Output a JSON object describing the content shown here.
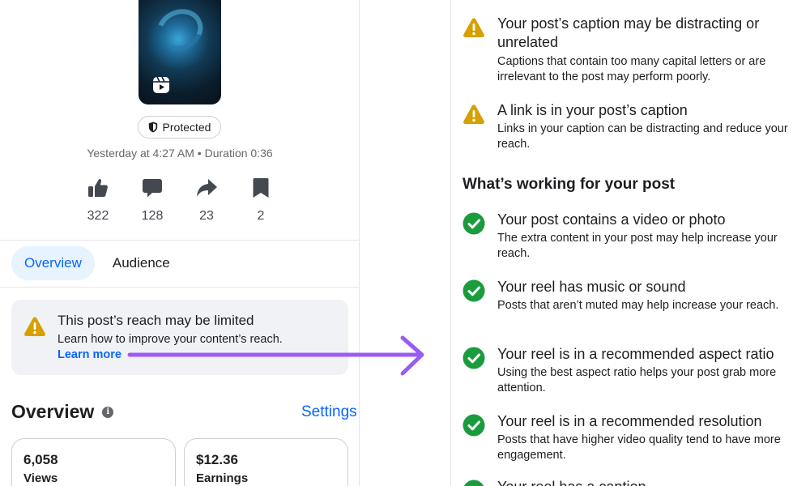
{
  "post": {
    "protected_label": "Protected",
    "meta": "Yesterday at 4:27 AM • Duration 0:36",
    "stats": [
      {
        "icon": "like-icon",
        "value": "322"
      },
      {
        "icon": "comment-icon",
        "value": "128"
      },
      {
        "icon": "share-icon",
        "value": "23"
      },
      {
        "icon": "save-icon",
        "value": "2"
      }
    ]
  },
  "tabs": [
    {
      "label": "Overview",
      "active": true
    },
    {
      "label": "Audience",
      "active": false
    }
  ],
  "reach_notice": {
    "title": "This post’s reach may be limited",
    "description": "Learn how to improve your content’s reach.",
    "link": "Learn more"
  },
  "overview": {
    "heading": "Overview",
    "settings_link": "Settings",
    "metrics": [
      {
        "value": "6,058",
        "label": "Views"
      },
      {
        "value": "$12.36",
        "label": "Earnings"
      }
    ]
  },
  "warnings": [
    {
      "title": "Your post’s caption may be distracting or unrelated",
      "description": "Captions that contain too many capital letters or are irrelevant to the post may perform poorly."
    },
    {
      "title": "A link is in your post’s caption",
      "description": "Links in your caption can be distracting and reduce your reach."
    }
  ],
  "working_section": {
    "heading": "What’s working for your post",
    "items": [
      {
        "title": "Your post contains a video or photo",
        "description": "The extra content in your post may help increase your reach."
      },
      {
        "title": "Your reel has music or sound",
        "description": "Posts that aren’t muted may help increase your reach."
      },
      {
        "title": "Your reel is in a recommended aspect ratio",
        "description": "Using the best aspect ratio helps your post grab more attention."
      },
      {
        "title": "Your reel is in a recommended resolution",
        "description": "Posts that have higher video quality tend to have more engagement."
      },
      {
        "title": "Your reel has a caption",
        "description": ""
      }
    ]
  },
  "colors": {
    "accent": "#0866ff",
    "warning": "#d6a000",
    "success": "#1a9c3e",
    "arrow": "#9b5cf5"
  }
}
